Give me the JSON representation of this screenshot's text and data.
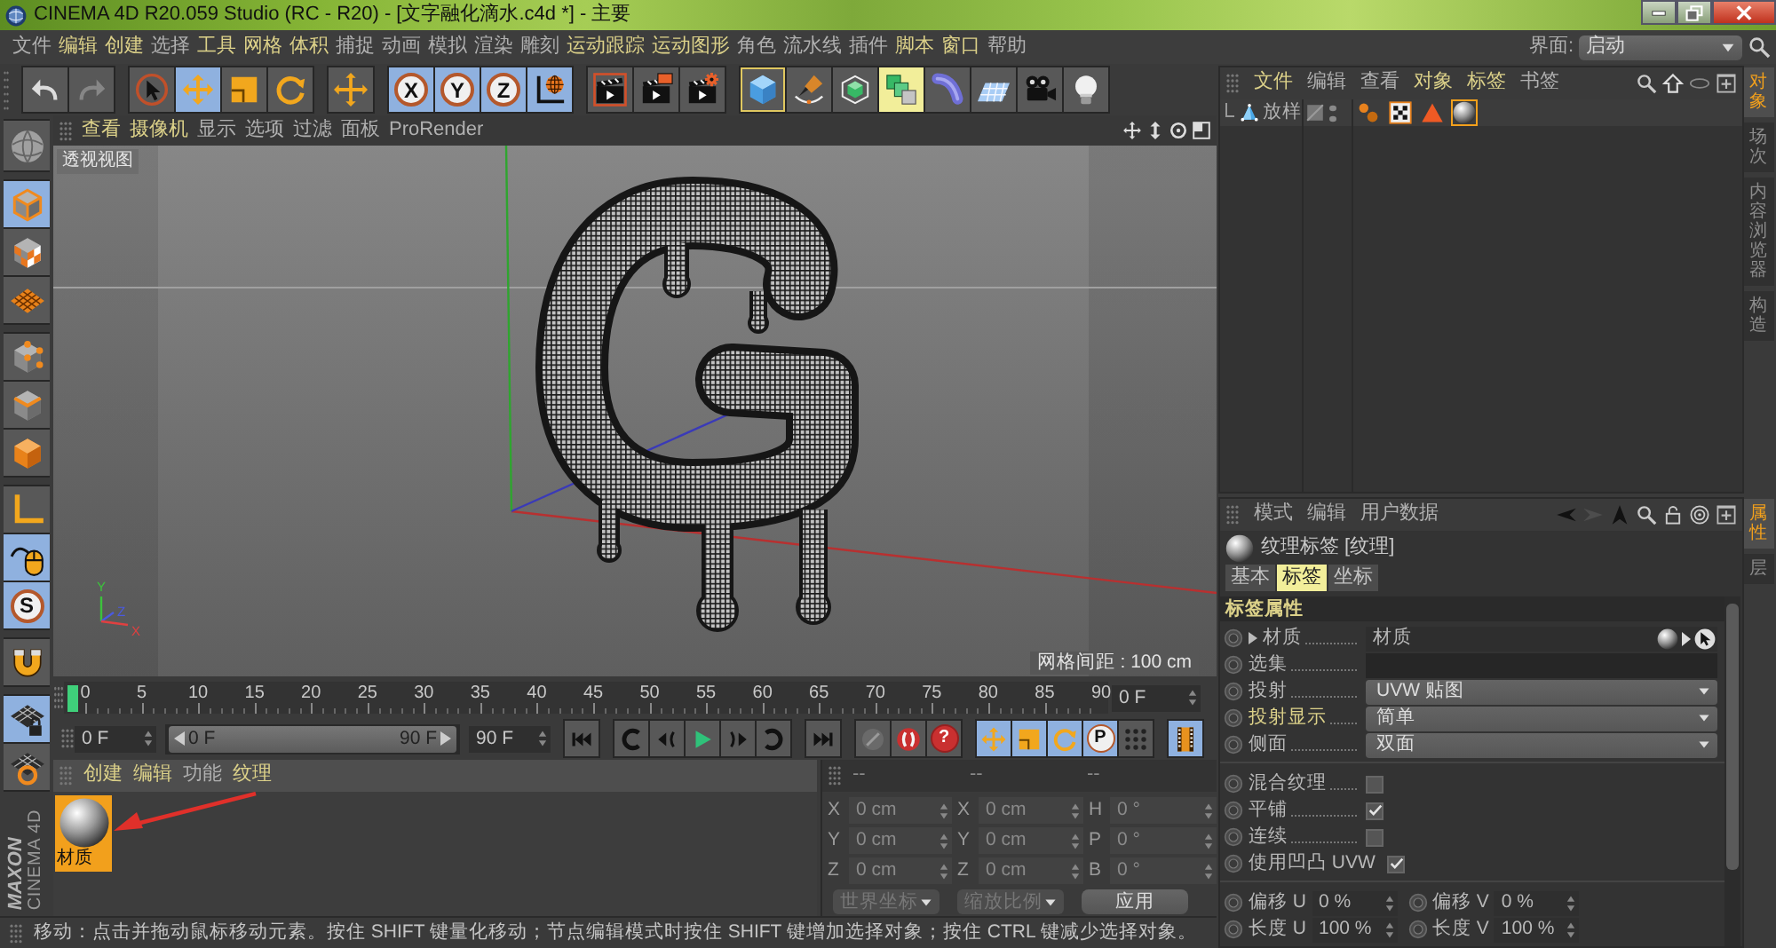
{
  "window": {
    "title": "CINEMA 4D R20.059 Studio (RC - R20) - [文字融化滴水.c4d *] - 主要"
  },
  "menu": [
    {
      "label": "文件",
      "highlighted": false
    },
    {
      "label": "编辑",
      "highlighted": true
    },
    {
      "label": "创建",
      "highlighted": true
    },
    {
      "label": "选择",
      "highlighted": false
    },
    {
      "label": "工具",
      "highlighted": true
    },
    {
      "label": "网格",
      "highlighted": true
    },
    {
      "label": "体积",
      "highlighted": true
    },
    {
      "label": "捕捉",
      "highlighted": false
    },
    {
      "label": "动画",
      "highlighted": false
    },
    {
      "label": "模拟",
      "highlighted": false
    },
    {
      "label": "渲染",
      "highlighted": false
    },
    {
      "label": "雕刻",
      "highlighted": false
    },
    {
      "label": "运动跟踪",
      "highlighted": true
    },
    {
      "label": "运动图形",
      "highlighted": true
    },
    {
      "label": "角色",
      "highlighted": false
    },
    {
      "label": "流水线",
      "highlighted": false
    },
    {
      "label": "插件",
      "highlighted": false
    },
    {
      "label": "脚本",
      "highlighted": true
    },
    {
      "label": "窗口",
      "highlighted": true
    },
    {
      "label": "帮助",
      "highlighted": false
    }
  ],
  "layout_selector": {
    "label": "界面:",
    "value": "启动"
  },
  "toolbar": {
    "groups": [
      {
        "items": [
          {
            "kind": "undo",
            "active": false,
            "disabled": false
          },
          {
            "kind": "redo",
            "active": false,
            "disabled": true
          }
        ]
      },
      {
        "items": [
          {
            "kind": "select",
            "active": false
          },
          {
            "kind": "move",
            "active": true
          },
          {
            "kind": "scale",
            "active": false
          },
          {
            "kind": "rotate",
            "active": false
          }
        ]
      },
      {
        "items": [
          {
            "kind": "transform",
            "active": false
          }
        ]
      },
      {
        "items": [
          {
            "kind": "axis",
            "label": "X",
            "active": true
          },
          {
            "kind": "axis",
            "label": "Y",
            "active": true
          },
          {
            "kind": "axis",
            "label": "Z",
            "active": true
          },
          {
            "kind": "coordinates",
            "active": true
          }
        ]
      },
      {
        "items": [
          {
            "kind": "render-view",
            "active": false
          },
          {
            "kind": "render-picture",
            "active": false
          },
          {
            "kind": "render-settings",
            "active": false
          }
        ]
      },
      {
        "items": [
          {
            "kind": "cube",
            "active": false,
            "framed": true,
            "highlighted": false
          },
          {
            "kind": "pen",
            "active": false,
            "framed": false,
            "highlighted": false
          },
          {
            "kind": "subdivision",
            "active": false,
            "framed": false,
            "highlighted": false
          },
          {
            "kind": "cloner",
            "active": false,
            "framed": false,
            "highlighted": true
          },
          {
            "kind": "deform",
            "active": false,
            "framed": false,
            "highlighted": false
          },
          {
            "kind": "floor",
            "active": false,
            "framed": false,
            "highlighted": false
          },
          {
            "kind": "camera",
            "active": false,
            "framed": false,
            "highlighted": false
          },
          {
            "kind": "light",
            "active": false,
            "framed": false,
            "highlighted": false
          }
        ]
      }
    ]
  },
  "mode_toolbar": {
    "groups": [
      {
        "items": [
          {
            "kind": "make-editable",
            "active": false
          }
        ]
      },
      {
        "items": [
          {
            "kind": "model",
            "active": true
          },
          {
            "kind": "texture",
            "active": false
          },
          {
            "kind": "workplane",
            "active": false
          }
        ]
      },
      {
        "items": [
          {
            "kind": "points",
            "active": false
          },
          {
            "kind": "edges",
            "active": false
          },
          {
            "kind": "polygons",
            "active": false
          }
        ]
      },
      {
        "items": [
          {
            "kind": "axis-mode",
            "active": false
          },
          {
            "kind": "tweak",
            "active": true
          },
          {
            "kind": "snap",
            "label": "S",
            "active": true
          }
        ]
      },
      {
        "items": [
          {
            "kind": "magnet",
            "active": false
          }
        ]
      },
      {
        "items": [
          {
            "kind": "lock-workplane",
            "active": true
          },
          {
            "kind": "planar-workplane",
            "active": false
          }
        ]
      }
    ]
  },
  "logo": {
    "brand": "MAXON",
    "product": "CINEMA 4D"
  },
  "viewport": {
    "menu": [
      {
        "label": "查看",
        "highlighted": true
      },
      {
        "label": "摄像机",
        "highlighted": true
      },
      {
        "label": "显示",
        "highlighted": false
      },
      {
        "label": "选项",
        "highlighted": false
      },
      {
        "label": "过滤",
        "highlighted": false
      },
      {
        "label": "面板",
        "highlighted": false
      },
      {
        "label": "ProRender",
        "highlighted": false
      }
    ],
    "view_name": "透视视图",
    "grid_spacing": "网格间距 : 100 cm",
    "axis_labels": [
      {
        "label": "Y",
        "color": "#3cc23c"
      },
      {
        "label": "Z",
        "color": "#4a5ae0"
      },
      {
        "label": "X",
        "color": "#e04040"
      }
    ]
  },
  "timeline": {
    "ticks": [
      "0",
      "5",
      "10",
      "15",
      "20",
      "25",
      "30",
      "35",
      "40",
      "45",
      "50",
      "55",
      "60",
      "65",
      "70",
      "75",
      "80",
      "85",
      "90"
    ],
    "level": 0,
    "frame": "0 F"
  },
  "playback": {
    "start": "0 F",
    "range": {
      "from": "0 F",
      "to": "90 F",
      "level": 1
    },
    "end": "90 F",
    "groups": [
      {
        "items": [
          {
            "kind": "go-start",
            "active": false
          }
        ]
      },
      {
        "items": [
          {
            "kind": "prev-key",
            "active": false
          },
          {
            "kind": "prev-frame",
            "active": false
          },
          {
            "kind": "play",
            "active": false
          },
          {
            "kind": "next-frame",
            "active": false
          },
          {
            "kind": "next-key",
            "active": false
          }
        ]
      },
      {
        "items": [
          {
            "kind": "go-end",
            "active": false
          }
        ]
      },
      {
        "items": [
          {
            "kind": "record",
            "active": false
          },
          {
            "kind": "autokey",
            "active": false
          },
          {
            "kind": "key-selection",
            "label": "?",
            "active": false
          }
        ]
      },
      {
        "items": [
          {
            "kind": "key-position",
            "active": true
          },
          {
            "kind": "key-scale",
            "active": true
          },
          {
            "kind": "key-rotation",
            "active": true
          },
          {
            "kind": "key-parameter",
            "label": "P",
            "active": true
          },
          {
            "kind": "key-pla",
            "active": false
          }
        ]
      },
      {
        "items": [
          {
            "kind": "timeline-window",
            "active": true
          }
        ]
      }
    ]
  },
  "material_manager": {
    "menu": [
      {
        "label": "创建",
        "highlighted": true
      },
      {
        "label": "编辑",
        "highlighted": true
      },
      {
        "label": "功能",
        "highlighted": false
      },
      {
        "label": "纹理",
        "highlighted": true
      }
    ],
    "materials": [
      {
        "name": "材质",
        "selected": true
      }
    ]
  },
  "coordinates": {
    "headers": [
      "--",
      "--",
      "--"
    ],
    "rows": [
      {
        "position_axis": "X",
        "position": "0 cm",
        "size_axis": "X",
        "size": "0 cm",
        "rotation_axis": "H",
        "rotation": "0 °"
      },
      {
        "position_axis": "Y",
        "position": "0 cm",
        "size_axis": "Y",
        "size": "0 cm",
        "rotation_axis": "P",
        "rotation": "0 °"
      },
      {
        "position_axis": "Z",
        "position": "0 cm",
        "size_axis": "Z",
        "size": "0 cm",
        "rotation_axis": "B",
        "rotation": "0 °"
      }
    ],
    "dropdowns": [
      {
        "value": "世界坐标",
        "disabled": true
      },
      {
        "value": "缩放比例",
        "disabled": true
      }
    ],
    "apply": "应用"
  },
  "status_bar": {
    "text": "移动：点击并拖动鼠标移动元素。按住 SHIFT 键量化移动；节点编辑模式时按住 SHIFT 键增加选择对象；按住 CTRL 键减少选择对象。"
  },
  "object_manager": {
    "menu": [
      {
        "label": "文件",
        "highlighted": true
      },
      {
        "label": "编辑",
        "highlighted": false
      },
      {
        "label": "查看",
        "highlighted": false
      },
      {
        "label": "对象",
        "highlighted": true
      },
      {
        "label": "标签",
        "highlighted": true
      },
      {
        "label": "书签",
        "highlighted": false
      }
    ],
    "objects": [
      {
        "name": "放样",
        "tags": [
          {
            "kind": "smoothing",
            "selected": false
          },
          {
            "kind": "texture",
            "selected": false
          },
          {
            "kind": "phong",
            "selected": false
          },
          {
            "kind": "material",
            "selected": true
          }
        ]
      }
    ],
    "side_tabs": [
      {
        "label": "对象",
        "selected": true
      },
      {
        "label": "场次",
        "selected": false
      },
      {
        "label": "内容浏览器",
        "selected": false
      },
      {
        "label": "构造",
        "selected": false
      }
    ]
  },
  "attributes": {
    "menu": [
      "模式",
      "编辑",
      "用户数据"
    ],
    "title": "纹理标签 [纹理]",
    "tabs": [
      {
        "label": "基本",
        "selected": false
      },
      {
        "label": "标签",
        "selected": true
      },
      {
        "label": "坐标",
        "selected": false
      }
    ],
    "section": "标签属性",
    "groups": [
      {
        "fields": [
          {
            "kind": "link",
            "label": "材质",
            "value": "材质",
            "expanded": false,
            "highlighted": false
          },
          {
            "kind": "text",
            "label": "选集",
            "highlighted": false
          },
          {
            "kind": "dropdown",
            "label": "投射",
            "value": "UVW 贴图",
            "highlighted": false
          },
          {
            "kind": "dropdown",
            "label": "投射显示",
            "value": "简单",
            "highlighted": true
          },
          {
            "kind": "dropdown",
            "label": "侧面",
            "value": "双面",
            "highlighted": false
          }
        ]
      },
      {
        "fields": [
          {
            "kind": "checkbox",
            "label": "混合纹理",
            "checked": false
          },
          {
            "kind": "checkbox",
            "label": "平铺",
            "checked": true
          },
          {
            "kind": "checkbox",
            "label": "连续",
            "checked": false
          },
          {
            "kind": "checkbox",
            "label": "使用凹凸 UVW",
            "checked": true
          }
        ]
      },
      {
        "fields": [
          {
            "kind": "pair",
            "items": [
              {
                "label": "偏移 U",
                "value": "0 %"
              },
              {
                "label": "偏移 V",
                "value": "0 %"
              }
            ]
          },
          {
            "kind": "pair",
            "items": [
              {
                "label": "长度 U",
                "value": "100 %"
              },
              {
                "label": "长度 V",
                "value": "100 %"
              }
            ]
          }
        ]
      }
    ],
    "side_tabs": [
      {
        "label": "属性",
        "selected": true
      },
      {
        "label": "层",
        "selected": false
      }
    ]
  }
}
